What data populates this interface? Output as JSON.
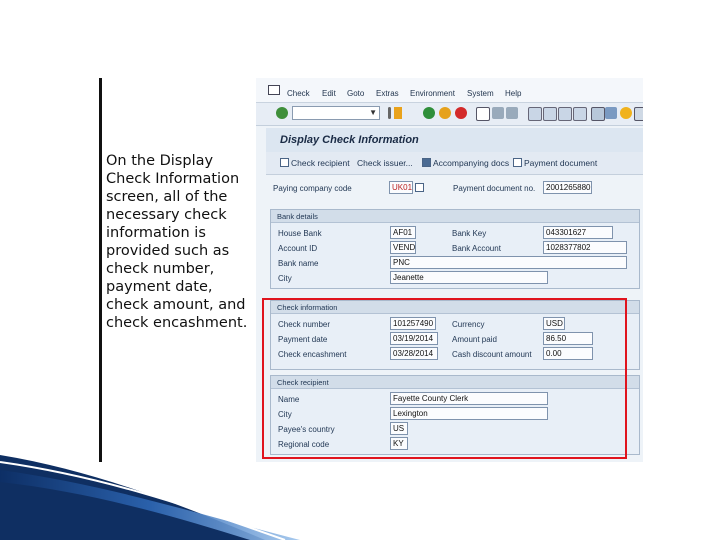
{
  "description": "On the Display Check Information screen, all of the necessary check information is provided such as check number, payment date, check amount, and check encashment.",
  "menu": [
    "Check",
    "Edit",
    "Goto",
    "Extras",
    "Environment",
    "System",
    "Help"
  ],
  "screen_title": "Display Check Information",
  "app_toolbar": {
    "check_recipient": "Check recipient",
    "check_issuer": "Check issuer...",
    "accompanying_docs": "Accompanying docs",
    "payment_document": "Payment document"
  },
  "header": {
    "paying_company_code_label": "Paying company code",
    "paying_company_code": "UK01",
    "payment_document_no_label": "Payment document no.",
    "payment_document_no": "2001265880"
  },
  "bank_details": {
    "title": "Bank details",
    "house_bank_label": "House Bank",
    "house_bank": "AF01",
    "bank_key_label": "Bank Key",
    "bank_key": "043301627",
    "account_id_label": "Account ID",
    "account_id": "VEND",
    "bank_account_label": "Bank Account",
    "bank_account": "1028377802",
    "bank_name_label": "Bank name",
    "bank_name": "PNC",
    "city_label": "City",
    "city": "Jeanette"
  },
  "check_information": {
    "title": "Check information",
    "check_number_label": "Check number",
    "check_number": "101257490",
    "currency_label": "Currency",
    "currency": "USD",
    "payment_date_label": "Payment date",
    "payment_date": "03/19/2014",
    "amount_paid_label": "Amount paid",
    "amount_paid": "86.50",
    "check_encashment_label": "Check encashment",
    "check_encashment": "03/28/2014",
    "cash_discount_label": "Cash discount amount",
    "cash_discount": "0.00"
  },
  "check_recipient": {
    "title": "Check recipient",
    "name_label": "Name",
    "name": "Fayette County Clerk",
    "city_label": "City",
    "city": "Lexington",
    "payees_country_label": "Payee's country",
    "payees_country": "US",
    "regional_code_label": "Regional code",
    "regional_code": "KY"
  },
  "colors": {
    "highlight": "#e0141e",
    "sap_background": "#eef3f8",
    "footer_blue": "#1e4f9a"
  }
}
